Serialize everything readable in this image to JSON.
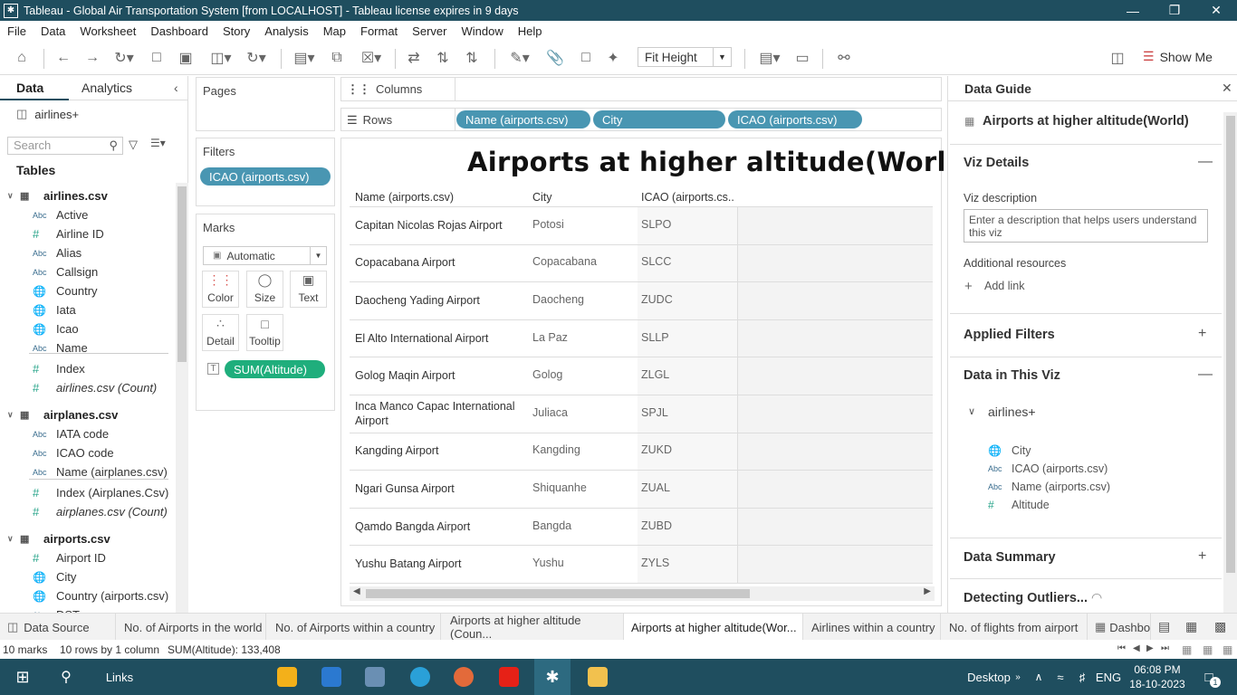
{
  "window": {
    "title": "Tableau - Global Air Transportation System [from LOCALHOST] - Tableau license expires in 9 days"
  },
  "menu": [
    "File",
    "Data",
    "Worksheet",
    "Dashboard",
    "Story",
    "Analysis",
    "Map",
    "Format",
    "Server",
    "Window",
    "Help"
  ],
  "toolbar": {
    "fit": "Fit Height",
    "show_me": "Show Me"
  },
  "left": {
    "tab_data": "Data",
    "tab_analytics": "Analytics",
    "source": "airlines+",
    "search_placeholder": "Search",
    "tables_heading": "Tables",
    "tables": [
      {
        "name": "airlines.csv",
        "fields": [
          {
            "type": "Abc",
            "name": "Active"
          },
          {
            "type": "#",
            "name": "Airline ID"
          },
          {
            "type": "Abc",
            "name": "Alias"
          },
          {
            "type": "Abc",
            "name": "Callsign"
          },
          {
            "type": "geo",
            "name": "Country"
          },
          {
            "type": "geo",
            "name": "Iata"
          },
          {
            "type": "geo",
            "name": "Icao"
          },
          {
            "type": "Abc",
            "name": "Name"
          },
          {
            "type": "#",
            "name": "Index"
          },
          {
            "type": "#",
            "name": "airlines.csv (Count)"
          }
        ]
      },
      {
        "name": "airplanes.csv",
        "fields": [
          {
            "type": "Abc",
            "name": "IATA code"
          },
          {
            "type": "Abc",
            "name": "ICAO code"
          },
          {
            "type": "Abc",
            "name": "Name (airplanes.csv)"
          },
          {
            "type": "#",
            "name": "Index (Airplanes.Csv)"
          },
          {
            "type": "#",
            "name": "airplanes.csv (Count)"
          }
        ]
      },
      {
        "name": "airports.csv",
        "fields": [
          {
            "type": "#",
            "name": "Airport ID"
          },
          {
            "type": "geo",
            "name": "City"
          },
          {
            "type": "geo",
            "name": "Country (airports.csv)"
          },
          {
            "type": "Abc",
            "name": "DST"
          }
        ]
      }
    ]
  },
  "shelves": {
    "pages": "Pages",
    "filters": "Filters",
    "filter_pill": "ICAO (airports.csv)",
    "marks": "Marks",
    "mark_type": "Automatic",
    "mark_buttons": [
      "Color",
      "Size",
      "Text",
      "Detail",
      "Tooltip"
    ],
    "text_pill": "SUM(Altitude)",
    "columns": "Columns",
    "rows": "Rows",
    "row_pills": [
      "Name (airports.csv)",
      "City",
      "ICAO (airports.csv)"
    ]
  },
  "viz": {
    "title": "Airports at higher altitude(World)",
    "headers": [
      "Name (airports.csv)",
      "City",
      "ICAO (airports.cs.."
    ],
    "rows": [
      {
        "name": "Capitan Nicolas Rojas Airport",
        "city": "Potosi",
        "icao": "SLPO"
      },
      {
        "name": "Copacabana Airport",
        "city": "Copacabana",
        "icao": "SLCC"
      },
      {
        "name": "Daocheng Yading Airport",
        "city": "Daocheng",
        "icao": "ZUDC"
      },
      {
        "name": "El Alto International Airport",
        "city": "La Paz",
        "icao": "SLLP"
      },
      {
        "name": "Golog Maqin Airport",
        "city": "Golog",
        "icao": "ZLGL"
      },
      {
        "name": "Inca Manco Capac International Airport",
        "city": "Juliaca",
        "icao": "SPJL"
      },
      {
        "name": "Kangding Airport",
        "city": "Kangding",
        "icao": "ZUKD"
      },
      {
        "name": "Ngari Gunsa Airport",
        "city": "Shiquanhe",
        "icao": "ZUAL"
      },
      {
        "name": "Qamdo Bangda Airport",
        "city": "Bangda",
        "icao": "ZUBD"
      },
      {
        "name": "Yushu Batang Airport",
        "city": "Yushu",
        "icao": "ZYLS"
      }
    ]
  },
  "guide": {
    "heading": "Data Guide",
    "sheet": "Airports at higher altitude(World)",
    "viz_details": "Viz Details",
    "viz_desc_label": "Viz description",
    "viz_desc_placeholder": "Enter a description that helps users understand this viz",
    "additional": "Additional resources",
    "add_link": "Add link",
    "applied_filters": "Applied Filters",
    "data_in_viz": "Data in This Viz",
    "source": "airlines+",
    "fields": [
      {
        "type": "geo",
        "name": "City"
      },
      {
        "type": "Abc",
        "name": "ICAO (airports.csv)"
      },
      {
        "type": "Abc",
        "name": "Name (airports.csv)"
      },
      {
        "type": "#",
        "name": "Altitude"
      }
    ],
    "data_summary": "Data Summary",
    "outliers": "Detecting Outliers..."
  },
  "sheet_tabs": [
    "Data Source",
    "No. of Airports in the world",
    "No. of Airports within a country",
    "Airports at higher altitude (Coun...",
    "Airports at higher altitude(Wor...",
    "Airlines within a country",
    "No. of flights from airport",
    "Dashbo"
  ],
  "status": {
    "marks": "10 marks",
    "rows": "10 rows by 1 column",
    "sum": "SUM(Altitude): 133,408"
  },
  "taskbar": {
    "links": "Links",
    "desktop": "Desktop",
    "lang": "ENG",
    "time": "06:08 PM",
    "date": "18-10-2023",
    "notif": "1"
  }
}
